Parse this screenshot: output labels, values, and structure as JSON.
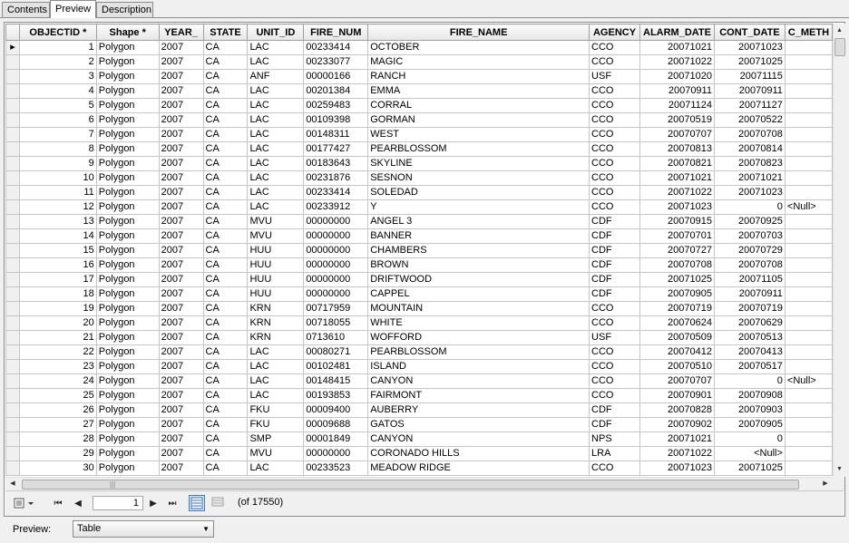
{
  "tabs": [
    "Contents",
    "Preview",
    "Description"
  ],
  "active_tab": 1,
  "columns": [
    "OBJECTID *",
    "Shape *",
    "YEAR_",
    "STATE",
    "UNIT_ID",
    "FIRE_NUM",
    "FIRE_NAME",
    "AGENCY",
    "ALARM_DATE",
    "CONT_DATE",
    "C_METH"
  ],
  "rows": [
    [
      "1",
      "Polygon",
      "2007",
      "CA",
      "LAC",
      "00233414",
      "OCTOBER",
      "CCO",
      "20071021",
      "20071023",
      ""
    ],
    [
      "2",
      "Polygon",
      "2007",
      "CA",
      "LAC",
      "00233077",
      "MAGIC",
      "CCO",
      "20071022",
      "20071025",
      ""
    ],
    [
      "3",
      "Polygon",
      "2007",
      "CA",
      "ANF",
      "00000166",
      "RANCH",
      "USF",
      "20071020",
      "20071115",
      ""
    ],
    [
      "4",
      "Polygon",
      "2007",
      "CA",
      "LAC",
      "00201384",
      "EMMA",
      "CCO",
      "20070911",
      "20070911",
      ""
    ],
    [
      "5",
      "Polygon",
      "2007",
      "CA",
      "LAC",
      "00259483",
      "CORRAL",
      "CCO",
      "20071124",
      "20071127",
      ""
    ],
    [
      "6",
      "Polygon",
      "2007",
      "CA",
      "LAC",
      "00109398",
      "GORMAN",
      "CCO",
      "20070519",
      "20070522",
      ""
    ],
    [
      "7",
      "Polygon",
      "2007",
      "CA",
      "LAC",
      "00148311",
      "WEST",
      "CCO",
      "20070707",
      "20070708",
      ""
    ],
    [
      "8",
      "Polygon",
      "2007",
      "CA",
      "LAC",
      "00177427",
      "PEARBLOSSOM",
      "CCO",
      "20070813",
      "20070814",
      ""
    ],
    [
      "9",
      "Polygon",
      "2007",
      "CA",
      "LAC",
      "00183643",
      "SKYLINE",
      "CCO",
      "20070821",
      "20070823",
      ""
    ],
    [
      "10",
      "Polygon",
      "2007",
      "CA",
      "LAC",
      "00231876",
      "SESNON",
      "CCO",
      "20071021",
      "20071021",
      ""
    ],
    [
      "11",
      "Polygon",
      "2007",
      "CA",
      "LAC",
      "00233414",
      "SOLEDAD",
      "CCO",
      "20071022",
      "20071023",
      ""
    ],
    [
      "12",
      "Polygon",
      "2007",
      "CA",
      "LAC",
      "00233912",
      "Y",
      "CCO",
      "20071023",
      "0",
      "<Null>"
    ],
    [
      "13",
      "Polygon",
      "2007",
      "CA",
      "MVU",
      "00000000",
      "ANGEL 3",
      "CDF",
      "20070915",
      "20070925",
      ""
    ],
    [
      "14",
      "Polygon",
      "2007",
      "CA",
      "MVU",
      "00000000",
      "BANNER",
      "CDF",
      "20070701",
      "20070703",
      ""
    ],
    [
      "15",
      "Polygon",
      "2007",
      "CA",
      "HUU",
      "00000000",
      "CHAMBERS",
      "CDF",
      "20070727",
      "20070729",
      ""
    ],
    [
      "16",
      "Polygon",
      "2007",
      "CA",
      "HUU",
      "00000000",
      "BROWN",
      "CDF",
      "20070708",
      "20070708",
      ""
    ],
    [
      "17",
      "Polygon",
      "2007",
      "CA",
      "HUU",
      "00000000",
      "DRIFTWOOD",
      "CDF",
      "20071025",
      "20071105",
      ""
    ],
    [
      "18",
      "Polygon",
      "2007",
      "CA",
      "HUU",
      "00000000",
      "CAPPEL",
      "CDF",
      "20070905",
      "20070911",
      ""
    ],
    [
      "19",
      "Polygon",
      "2007",
      "CA",
      "KRN",
      "00717959",
      "MOUNTAIN",
      "CCO",
      "20070719",
      "20070719",
      ""
    ],
    [
      "20",
      "Polygon",
      "2007",
      "CA",
      "KRN",
      "00718055",
      "WHITE",
      "CCO",
      "20070624",
      "20070629",
      ""
    ],
    [
      "21",
      "Polygon",
      "2007",
      "CA",
      "KRN",
      "0713610",
      "WOFFORD",
      "USF",
      "20070509",
      "20070513",
      ""
    ],
    [
      "22",
      "Polygon",
      "2007",
      "CA",
      "LAC",
      "00080271",
      "PEARBLOSSOM",
      "CCO",
      "20070412",
      "20070413",
      ""
    ],
    [
      "23",
      "Polygon",
      "2007",
      "CA",
      "LAC",
      "00102481",
      "ISLAND",
      "CCO",
      "20070510",
      "20070517",
      ""
    ],
    [
      "24",
      "Polygon",
      "2007",
      "CA",
      "LAC",
      "00148415",
      "CANYON",
      "CCO",
      "20070707",
      "0",
      "<Null>"
    ],
    [
      "25",
      "Polygon",
      "2007",
      "CA",
      "LAC",
      "00193853",
      "FAIRMONT",
      "CCO",
      "20070901",
      "20070908",
      ""
    ],
    [
      "26",
      "Polygon",
      "2007",
      "CA",
      "FKU",
      "00009400",
      "AUBERRY",
      "CDF",
      "20070828",
      "20070903",
      ""
    ],
    [
      "27",
      "Polygon",
      "2007",
      "CA",
      "FKU",
      "00009688",
      "GATOS",
      "CDF",
      "20070902",
      "20070905",
      ""
    ],
    [
      "28",
      "Polygon",
      "2007",
      "CA",
      "SMP",
      "00001849",
      "CANYON",
      "NPS",
      "20071021",
      "0",
      ""
    ],
    [
      "29",
      "Polygon",
      "2007",
      "CA",
      "MVU",
      "00000000",
      "CORONADO HILLS",
      "LRA",
      "20071022",
      "<Null>",
      ""
    ],
    [
      "30",
      "Polygon",
      "2007",
      "CA",
      "LAC",
      "00233523",
      "MEADOW RIDGE",
      "CCO",
      "20071023",
      "20071025",
      ""
    ]
  ],
  "navigation": {
    "current_record": "1",
    "record_count": "(of 17550)"
  },
  "preview": {
    "label": "Preview:",
    "selected": "Table"
  },
  "icons": {
    "row_pointer": "▸",
    "first": "⏮",
    "prev": "◀",
    "next": "▶",
    "last": "⏭"
  }
}
